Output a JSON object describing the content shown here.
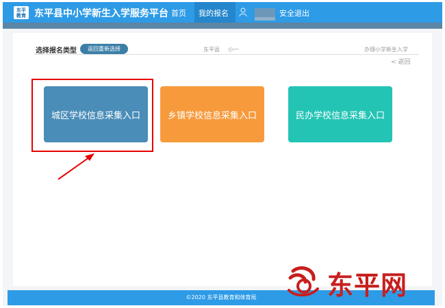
{
  "header": {
    "logo_text": "东平\n教育",
    "title": "东平县中小学新生入学服务平台",
    "nav": [
      {
        "label": "首页"
      },
      {
        "label": "我的报名"
      }
    ],
    "logout_label": "安全退出"
  },
  "breadcrumb": {
    "title": "选择报名类型",
    "return_button": "返回重新选择",
    "county": "东平县",
    "grade": "小一",
    "type": "办理小学新生入学",
    "back_link": "< 返回"
  },
  "cards": [
    {
      "label": "城区学校信息采集入口",
      "color": "#4a8db8"
    },
    {
      "label": "乡镇学校信息采集入口",
      "color": "#f79a3c"
    },
    {
      "label": "民办学校信息采集入口",
      "color": "#24c4b5"
    }
  ],
  "footer": {
    "text": "©2020  东平县教育和体育局"
  },
  "watermark": {
    "text": "东平网"
  },
  "colors": {
    "header": "#2e9be6",
    "highlight": "#e60000"
  }
}
